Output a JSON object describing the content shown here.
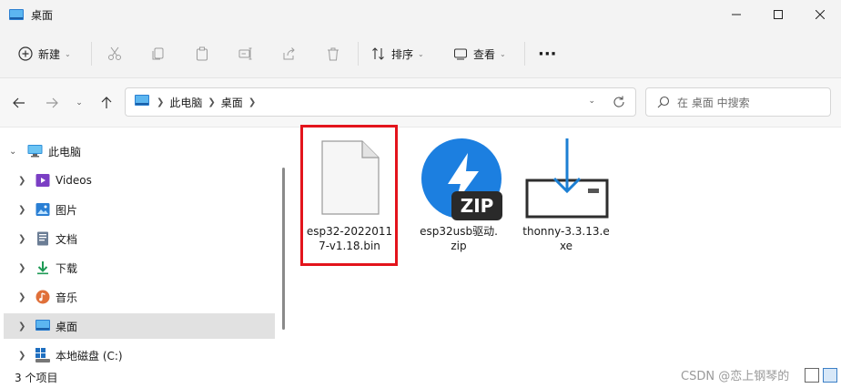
{
  "window": {
    "title": "桌面",
    "minimize_icon": "minimize-icon",
    "maximize_icon": "maximize-icon",
    "close_icon": "close-icon"
  },
  "commandbar": {
    "new_label": "新建",
    "sort_label": "排序",
    "view_label": "查看",
    "more_label": "···"
  },
  "address": {
    "crumbs": [
      "此电脑",
      "桌面"
    ]
  },
  "search": {
    "placeholder": "在 桌面 中搜索"
  },
  "navpane": {
    "items": [
      {
        "label": "此电脑",
        "icon": "monitor-icon"
      },
      {
        "label": "Videos",
        "icon": "videos-icon"
      },
      {
        "label": "图片",
        "icon": "pictures-icon"
      },
      {
        "label": "文档",
        "icon": "documents-icon"
      },
      {
        "label": "下载",
        "icon": "downloads-icon"
      },
      {
        "label": "音乐",
        "icon": "music-icon"
      },
      {
        "label": "桌面",
        "icon": "desktop-icon"
      },
      {
        "label": "本地磁盘 (C:)",
        "icon": "drive-icon"
      }
    ]
  },
  "files": [
    {
      "line1": "esp32-2022011",
      "line2": "7-v1.18.bin",
      "icon": "generic-file-icon"
    },
    {
      "line1": "esp32usb驱动.",
      "line2": "zip",
      "icon": "zip-archive-icon",
      "badge": "ZIP"
    },
    {
      "line1": "thonny-3.3.13.e",
      "line2": "xe",
      "icon": "installer-icon"
    }
  ],
  "status": {
    "count": "3 个项目"
  },
  "watermark": "CSDN @恋上钢琴的"
}
